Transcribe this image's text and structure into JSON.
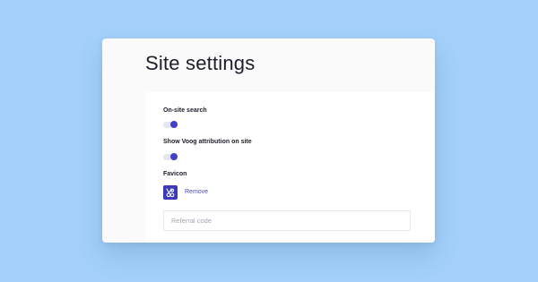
{
  "page": {
    "title": "Site settings"
  },
  "settings": {
    "onsite_search": {
      "label": "On-site search",
      "enabled": true
    },
    "voog_attribution": {
      "label": "Show Voog attribution on site",
      "enabled": true
    },
    "favicon": {
      "label": "Favicon",
      "remove_label": "Remove",
      "icon": "voog-logo-icon"
    },
    "referral": {
      "placeholder": "Referral code",
      "value": ""
    }
  },
  "colors": {
    "background": "#a4d0fb",
    "accent": "#4240c8",
    "favicon_bg": "#3c3ab8",
    "link": "#4a48c6"
  }
}
